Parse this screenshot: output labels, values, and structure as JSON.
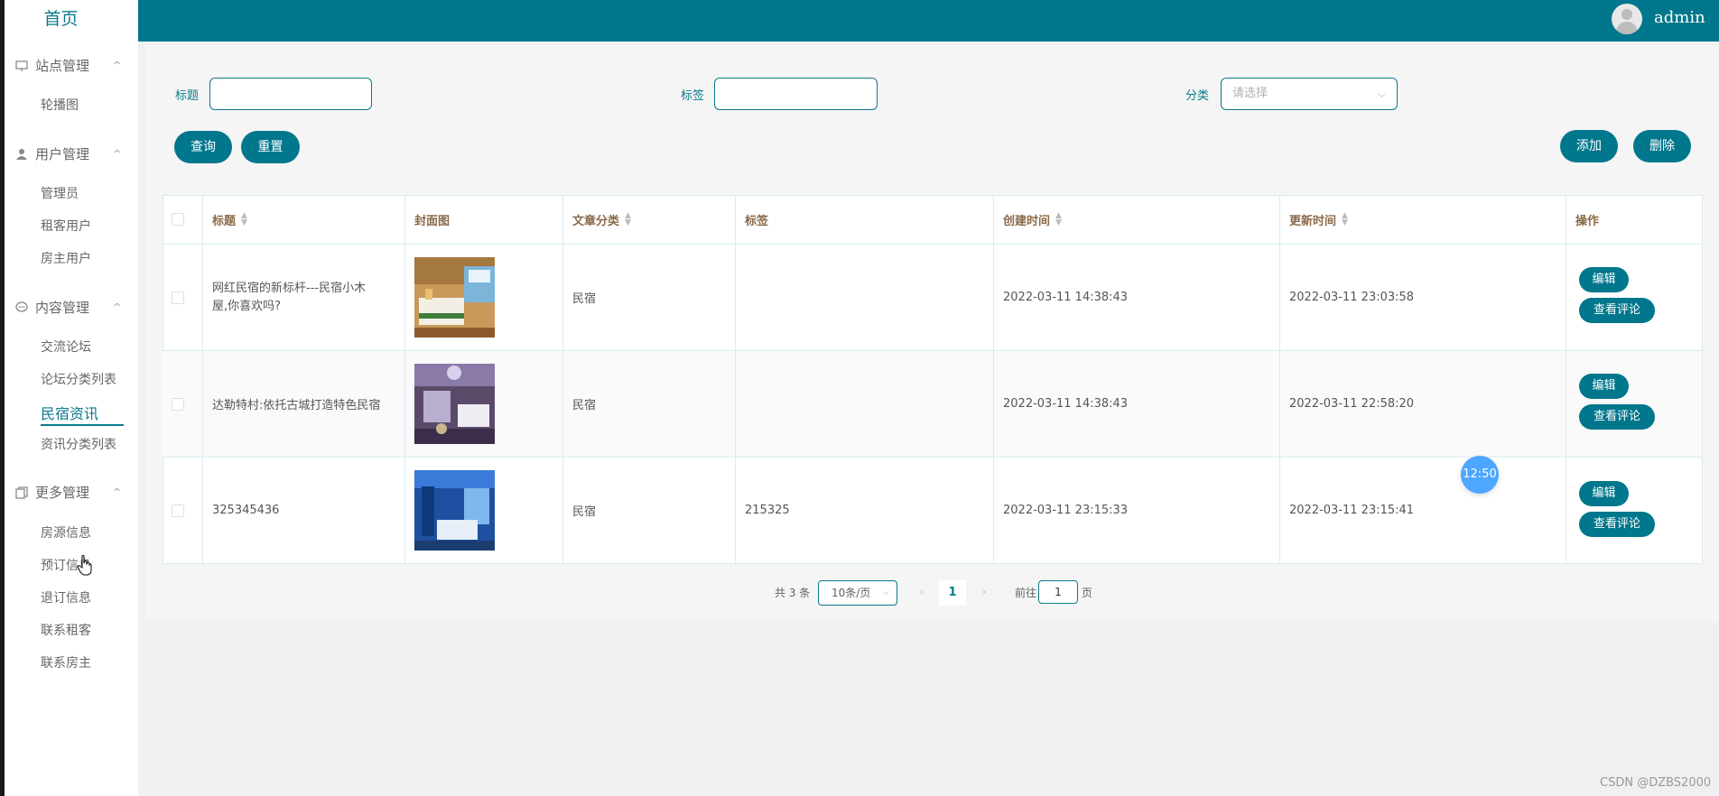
{
  "sidebar": {
    "home": "首页",
    "groups": [
      {
        "label": "站点管理",
        "icon": "monitor-icon",
        "items": [
          "轮播图"
        ]
      },
      {
        "label": "用户管理",
        "icon": "user-icon",
        "items": [
          "管理员",
          "租客用户",
          "房主用户"
        ]
      },
      {
        "label": "内容管理",
        "icon": "chat-icon",
        "items": [
          "交流论坛",
          "论坛分类列表",
          "民宿资讯",
          "资讯分类列表"
        ]
      },
      {
        "label": "更多管理",
        "icon": "copy-icon",
        "items": [
          "房源信息",
          "预订信息",
          "退订信息",
          "联系租客",
          "联系房主"
        ]
      }
    ],
    "active_item": "民宿资讯",
    "chevron": "^"
  },
  "header": {
    "username": "admin"
  },
  "filters": {
    "title_label": "标题",
    "tag_label": "标签",
    "category_label": "分类",
    "category_placeholder": "请选择"
  },
  "buttons": {
    "query": "查询",
    "reset": "重置",
    "add": "添加",
    "delete": "删除"
  },
  "table": {
    "headers": [
      "标题",
      "封面图",
      "文章分类",
      "标签",
      "创建时间",
      "更新时间",
      "操作"
    ],
    "rows": [
      {
        "title": "网红民宿的新标杆---民宿小木屋,你喜欢吗?",
        "category": "民宿",
        "tag": "",
        "created": "2022-03-11 14:38:43",
        "updated": "2022-03-11 23:03:58",
        "cover": "warm-hotel-room"
      },
      {
        "title": "达勒特村:依托古城打造特色民宿",
        "category": "民宿",
        "tag": "",
        "created": "2022-03-11 14:38:43",
        "updated": "2022-03-11 22:58:20",
        "cover": "purple-hotel-room"
      },
      {
        "title": "325345436",
        "category": "民宿",
        "tag": "215325",
        "created": "2022-03-11 23:15:33",
        "updated": "2022-03-11 23:15:41",
        "cover": "blue-hotel-room"
      }
    ],
    "edit_label": "编辑",
    "comments_label": "查看评论"
  },
  "pagination": {
    "total_text": "共 3 条",
    "page_size": "10条/页",
    "current_page": "1",
    "goto_prefix": "前往",
    "goto_value": "1",
    "goto_suffix": "页",
    "prev": "‹",
    "next": "›"
  },
  "badge": {
    "time": "12:50"
  },
  "watermark": "CSDN @DZBS2000",
  "colors": {
    "primary": "#00778c",
    "badge": "#4da6ff"
  }
}
